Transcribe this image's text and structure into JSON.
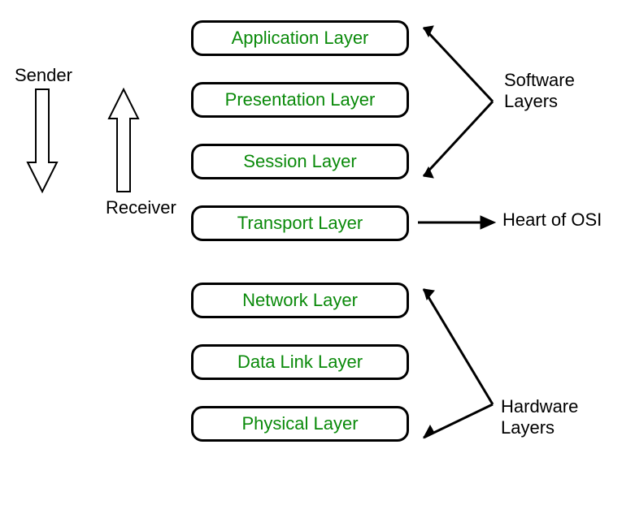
{
  "layers": [
    {
      "label": "Application Layer"
    },
    {
      "label": "Presentation Layer"
    },
    {
      "label": "Session Layer"
    },
    {
      "label": "Transport Layer"
    },
    {
      "label": "Network Layer"
    },
    {
      "label": "Data Link Layer"
    },
    {
      "label": "Physical Layer"
    }
  ],
  "annotations": {
    "sender": "Sender",
    "receiver": "Receiver",
    "software_layers_line1": "Software",
    "software_layers_line2": "Layers",
    "heart_of_osi": "Heart of OSI",
    "hardware_layers_line1": "Hardware",
    "hardware_layers_line2": "Layers"
  }
}
